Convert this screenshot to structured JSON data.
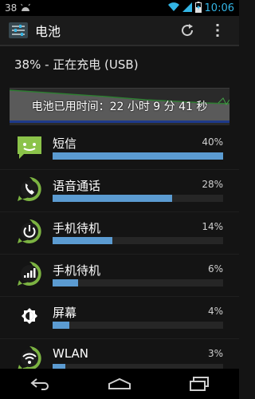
{
  "status_bar": {
    "notification_count": "38",
    "time": "10:06",
    "icons": [
      "android-notification-icon",
      "wifi-icon",
      "signal-icon",
      "battery-charging-icon"
    ]
  },
  "action_bar": {
    "title": "电池",
    "app_icon": "settings-sliders-icon",
    "actions": [
      "refresh-icon",
      "overflow-menu-icon"
    ]
  },
  "battery": {
    "summary": "38% - 正在充电 (USB)",
    "usage_time": "电池已用时间：22 小时 9 分 41 秒"
  },
  "usage_items": [
    {
      "label": "短信",
      "percent": "40%",
      "value": 40,
      "icon": "messaging-icon"
    },
    {
      "label": "语音通话",
      "percent": "28%",
      "value": 28,
      "icon": "phone-call-icon"
    },
    {
      "label": "手机待机",
      "percent": "14%",
      "value": 14,
      "icon": "power-icon"
    },
    {
      "label": "手机待机",
      "percent": "6%",
      "value": 6,
      "icon": "cell-signal-icon"
    },
    {
      "label": "屏幕",
      "percent": "4%",
      "value": 4,
      "icon": "brightness-icon"
    },
    {
      "label": "WLAN",
      "percent": "3%",
      "value": 3,
      "icon": "wifi-icon"
    }
  ],
  "nav_bar": [
    "back-icon",
    "home-icon",
    "recent-apps-icon"
  ],
  "colors": {
    "accent": "#33b5e5",
    "bar_fill": "#5b9bd1",
    "graph_line": "#2e7d32",
    "icon_green": "#7cb342"
  }
}
